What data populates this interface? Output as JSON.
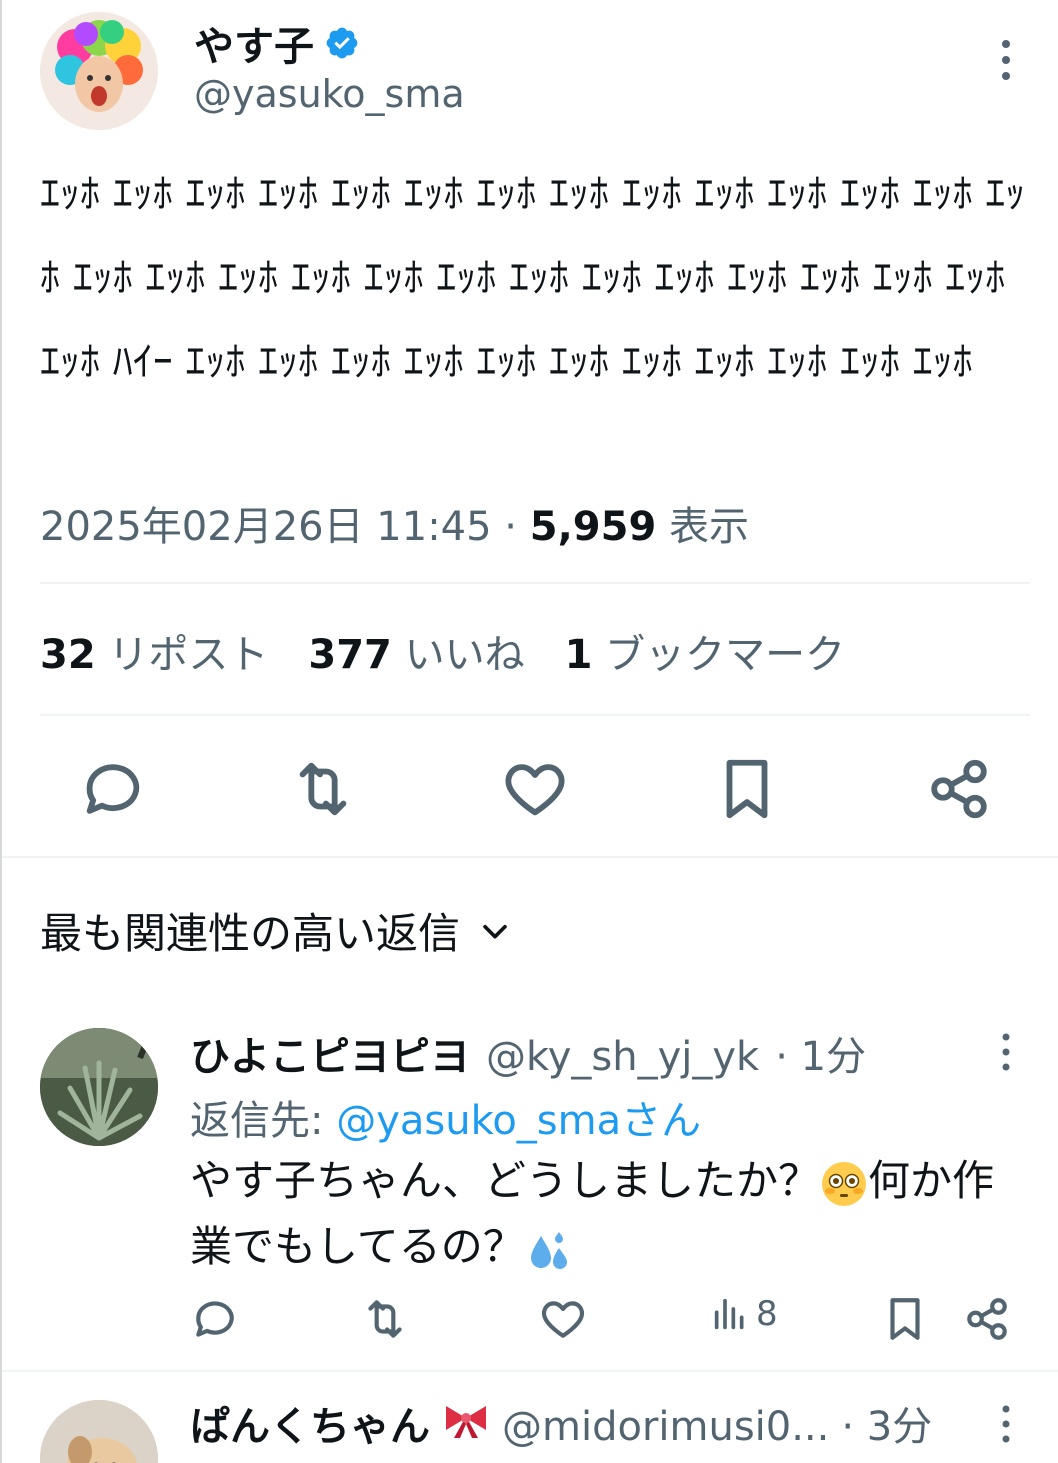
{
  "tweet": {
    "author_name": "やす子",
    "author_handle": "@yasuko_sma",
    "text": "ｴｯﾎ ｴｯﾎ ｴｯﾎ ｴｯﾎ ｴｯﾎ ｴｯﾎ ｴｯﾎ ｴｯﾎ ｴｯﾎ ｴｯﾎ ｴｯﾎ ｴｯﾎ ｴｯﾎ ｴｯﾎ ｴｯﾎ ｴｯﾎ ｴｯﾎ ｴｯﾎ ｴｯﾎ ｴｯﾎ ｴｯﾎ ｴｯﾎ ｴｯﾎ ｴｯﾎ ｴｯﾎ ｴｯﾎ ｴｯﾎ ｴｯﾎ ﾊｲｰ ｴｯﾎ ｴｯﾎ ｴｯﾎ ｴｯﾎ ｴｯﾎ ｴｯﾎ ｴｯﾎ ｴｯﾎ ｴｯﾎ ｴｯﾎ ｴｯﾎ",
    "timestamp": "2025年02月26日 11:45",
    "separator": " · ",
    "views_count": "5,959",
    "views_label": "表示"
  },
  "stats": {
    "reposts_count": "32",
    "reposts_label": "リポスト",
    "likes_count": "377",
    "likes_label": "いいね",
    "bookmarks_count": "1",
    "bookmarks_label": "ブックマーク"
  },
  "icons": {
    "verified": "verified-badge-icon",
    "more": "more-vertical-icon",
    "reply": "reply-icon",
    "repost": "repost-icon",
    "like": "heart-icon",
    "bookmark": "bookmark-icon",
    "share": "share-icon",
    "views": "views-icon",
    "chevron": "chevron-down-icon"
  },
  "colors": {
    "accent": "#1d9bf0",
    "text": "#0f1419",
    "secondary": "#536471"
  },
  "sort": {
    "label": "最も関連性の高い返信"
  },
  "replies": [
    {
      "name": "ひよこピヨピヨ",
      "handle": "@ky_sh_yj_yk",
      "time": "· 1分",
      "reply_to_prefix": "返信先: ",
      "reply_to_mention": "@yasuko_smaさん",
      "text_part1": "やす子ちゃん、どうしましたか？",
      "text_part2": "何か作業でもしてるの？",
      "views": "8"
    },
    {
      "name": "ぱんくちゃん",
      "handle": "@midorimusi0...",
      "time": "· 3分"
    }
  ]
}
